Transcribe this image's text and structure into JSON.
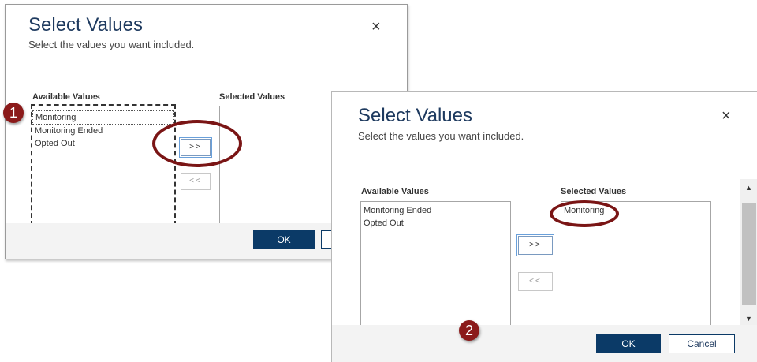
{
  "dialog1": {
    "title": "Select Values",
    "subtitle": "Select the values you want included.",
    "close_glyph": "×",
    "available_label": "Available Values",
    "selected_label": "Selected Values",
    "available_items": [
      "Monitoring",
      "Monitoring Ended",
      "Opted Out"
    ],
    "add_label": ">>",
    "remove_label": "<<",
    "ok_label": "OK"
  },
  "dialog2": {
    "title": "Select Values",
    "subtitle": "Select the values you want included.",
    "close_glyph": "×",
    "available_label": "Available Values",
    "selected_label": "Selected Values",
    "available_items": [
      "Monitoring Ended",
      "Opted Out"
    ],
    "selected_items": [
      "Monitoring"
    ],
    "add_label": ">>",
    "remove_label": "<<",
    "ok_label": "OK",
    "cancel_label": "Cancel",
    "scroll_up_glyph": "▲",
    "scroll_down_glyph": "▼"
  },
  "callouts": {
    "step1": "1",
    "step2": "2",
    "color": "#8b1a1a"
  }
}
